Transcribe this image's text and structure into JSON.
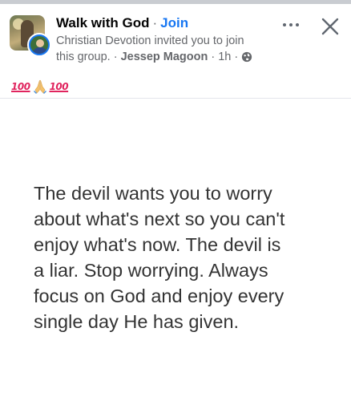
{
  "post": {
    "group_name": "Walk with God",
    "title_dot": "·",
    "join_label": "Join",
    "invite_line1": "Christian Devotion invited you to join",
    "invite_line2_prefix": "this group. ·",
    "author": "Jessep Magoon",
    "time_sep": "·",
    "time": "1h",
    "time_dot": "·",
    "privacy_icon": "globe-icon",
    "text_emoji": {
      "left": "100",
      "middle_icon": "folded-hands-icon",
      "right": "100"
    }
  },
  "actions": {
    "more_icon": "more-horizontal-icon",
    "close_icon": "close-icon"
  },
  "quote_image": {
    "text": "The devil wants you to worry\nabout what's next so you can't\nenjoy what's now. The devil is\na liar. Stop worrying. Always\nfocus on God and enjoy every\nsingle day He has given."
  },
  "colors": {
    "link_blue": "#1877f2",
    "secondary_text": "#65676b",
    "emoji_red": "#e0245e"
  }
}
